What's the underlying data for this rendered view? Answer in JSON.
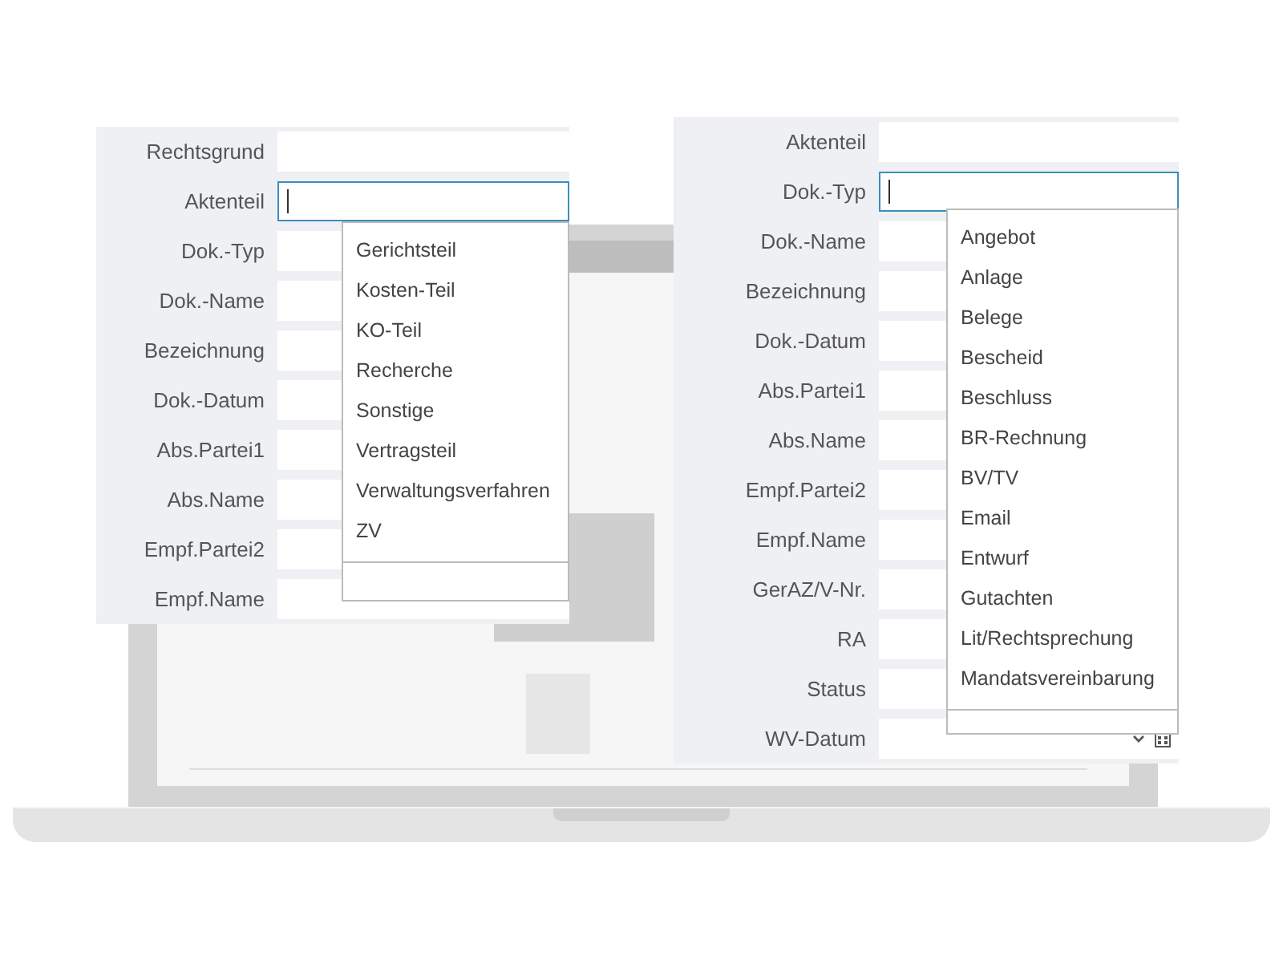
{
  "left_form": {
    "fields": [
      {
        "label": "Rechtsgrund",
        "kind": "text",
        "focused": false
      },
      {
        "label": "Aktenteil",
        "kind": "text",
        "focused": true
      },
      {
        "label": "Dok.-Typ",
        "kind": "text",
        "focused": false
      },
      {
        "label": "Dok.-Name",
        "kind": "text",
        "focused": false
      },
      {
        "label": "Bezeichnung",
        "kind": "text",
        "focused": false
      },
      {
        "label": "Dok.-Datum",
        "kind": "text",
        "focused": false
      },
      {
        "label": "Abs.Partei1",
        "kind": "text",
        "focused": false
      },
      {
        "label": "Abs.Name",
        "kind": "text",
        "focused": false
      },
      {
        "label": "Empf.Partei2",
        "kind": "text",
        "focused": false
      },
      {
        "label": "Empf.Name",
        "kind": "text",
        "focused": false
      }
    ],
    "dropdown": {
      "options": [
        "Gerichtsteil",
        "Kosten-Teil",
        "KO-Teil",
        "Recherche",
        "Sonstige",
        "Vertragsteil",
        "Verwaltungsverfahren",
        "ZV"
      ]
    }
  },
  "right_form": {
    "fields": [
      {
        "label": "Aktenteil",
        "kind": "text",
        "focused": false
      },
      {
        "label": "Dok.-Typ",
        "kind": "text",
        "focused": true
      },
      {
        "label": "Dok.-Name",
        "kind": "text",
        "focused": false
      },
      {
        "label": "Bezeichnung",
        "kind": "text",
        "focused": false
      },
      {
        "label": "Dok.-Datum",
        "kind": "text",
        "focused": false
      },
      {
        "label": "Abs.Partei1",
        "kind": "text",
        "focused": false
      },
      {
        "label": "Abs.Name",
        "kind": "text",
        "focused": false
      },
      {
        "label": "Empf.Partei2",
        "kind": "text",
        "focused": false
      },
      {
        "label": "Empf.Name",
        "kind": "text",
        "focused": false
      },
      {
        "label": "GerAZ/V-Nr.",
        "kind": "text",
        "focused": false
      },
      {
        "label": "RA",
        "kind": "text",
        "focused": false
      },
      {
        "label": "Status",
        "kind": "text",
        "focused": false
      },
      {
        "label": "WV-Datum",
        "kind": "date",
        "focused": false
      }
    ],
    "dropdown": {
      "options": [
        "Angebot",
        "Anlage",
        "Belege",
        "Bescheid",
        "Beschluss",
        "BR-Rechnung",
        "BV/TV",
        "Email",
        "Entwurf",
        "Gutachten",
        "Lit/Rechtsprechung",
        "Mandatsvereinbarung"
      ]
    }
  }
}
